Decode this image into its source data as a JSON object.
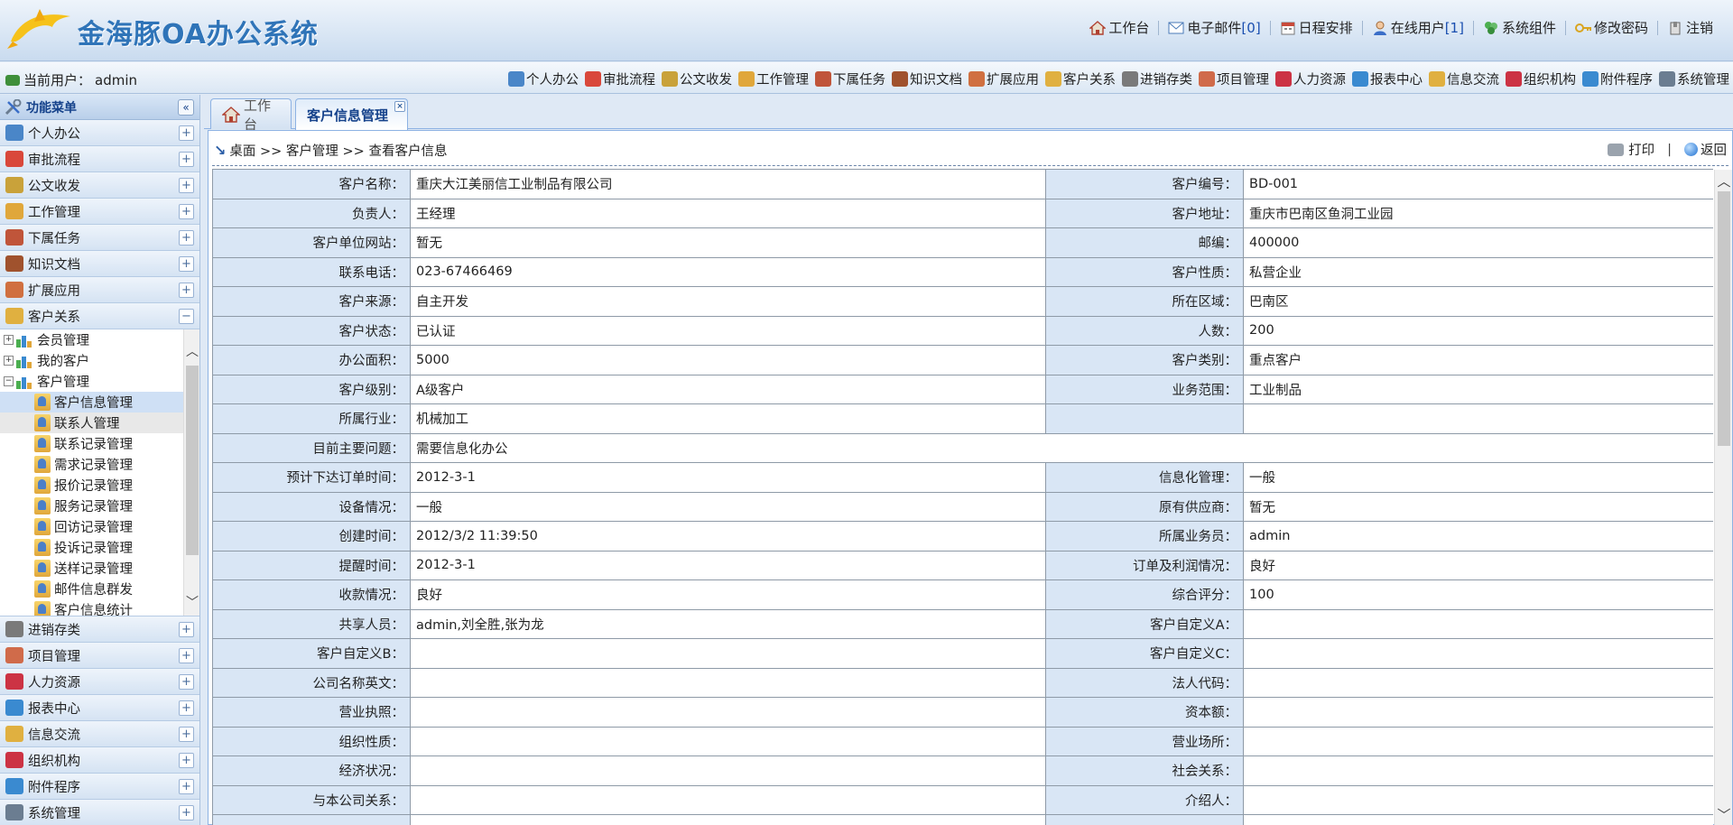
{
  "app": {
    "title": "金海豚OA办公系统"
  },
  "top_nav": [
    {
      "label": "工作台",
      "icon": "home-icon"
    },
    {
      "label": "电子邮件",
      "count": "[0]",
      "icon": "mail-icon"
    },
    {
      "label": "日程安排",
      "icon": "calendar-icon"
    },
    {
      "label": "在线用户",
      "count": "[1]",
      "icon": "user-icon"
    },
    {
      "label": "系统组件",
      "icon": "puzzle-icon"
    },
    {
      "label": "修改密码",
      "icon": "key-icon"
    },
    {
      "label": "注销",
      "icon": "logout-icon"
    }
  ],
  "current_user": {
    "label": "当前用户：",
    "name": "admin"
  },
  "module_nav": [
    {
      "label": "个人办公",
      "color": "#4a86c8"
    },
    {
      "label": "审批流程",
      "color": "#d9483b"
    },
    {
      "label": "公文收发",
      "color": "#c9a23a"
    },
    {
      "label": "工作管理",
      "color": "#e0a73b"
    },
    {
      "label": "下属任务",
      "color": "#c0553a"
    },
    {
      "label": "知识文档",
      "color": "#a0522d"
    },
    {
      "label": "扩展应用",
      "color": "#d07040"
    },
    {
      "label": "客户关系",
      "color": "#e0b040"
    },
    {
      "label": "进销存类",
      "color": "#7a7a7a"
    },
    {
      "label": "项目管理",
      "color": "#d06b4a"
    },
    {
      "label": "人力资源",
      "color": "#cc3344"
    },
    {
      "label": "报表中心",
      "color": "#3a8ad0"
    },
    {
      "label": "信息交流",
      "color": "#e0b040"
    },
    {
      "label": "组织机构",
      "color": "#cc3344"
    },
    {
      "label": "附件程序",
      "color": "#3a8ad0"
    },
    {
      "label": "系统管理",
      "color": "#6b7d91"
    }
  ],
  "sidebar": {
    "title": "功能菜单",
    "top_items": [
      {
        "label": "个人办公",
        "color": "#4a86c8"
      },
      {
        "label": "审批流程",
        "color": "#d9483b"
      },
      {
        "label": "公文收发",
        "color": "#c9a23a"
      },
      {
        "label": "工作管理",
        "color": "#e0a73b"
      },
      {
        "label": "下属任务",
        "color": "#c0553a"
      },
      {
        "label": "知识文档",
        "color": "#a0522d"
      },
      {
        "label": "扩展应用",
        "color": "#d07040"
      },
      {
        "label": "客户关系",
        "color": "#e0b040",
        "expanded": true
      }
    ],
    "tree": [
      {
        "label": "会员管理",
        "level": 0,
        "expand": "+"
      },
      {
        "label": "我的客户",
        "level": 0,
        "expand": "+"
      },
      {
        "label": "客户管理",
        "level": 0,
        "expand": "-"
      },
      {
        "label": "客户信息管理",
        "level": 1,
        "selected": true
      },
      {
        "label": "联系人管理",
        "level": 1,
        "hover": true
      },
      {
        "label": "联系记录管理",
        "level": 1
      },
      {
        "label": "需求记录管理",
        "level": 1
      },
      {
        "label": "报价记录管理",
        "level": 1
      },
      {
        "label": "服务记录管理",
        "level": 1
      },
      {
        "label": "回访记录管理",
        "level": 1
      },
      {
        "label": "投诉记录管理",
        "level": 1
      },
      {
        "label": "送样记录管理",
        "level": 1
      },
      {
        "label": "邮件信息群发",
        "level": 1
      },
      {
        "label": "客户信息统计",
        "level": 1
      }
    ],
    "bottom_items": [
      {
        "label": "进销存类",
        "color": "#7a7a7a"
      },
      {
        "label": "项目管理",
        "color": "#d06b4a"
      },
      {
        "label": "人力资源",
        "color": "#cc3344"
      },
      {
        "label": "报表中心",
        "color": "#3a8ad0"
      },
      {
        "label": "信息交流",
        "color": "#e0b040"
      },
      {
        "label": "组织机构",
        "color": "#cc3344"
      },
      {
        "label": "附件程序",
        "color": "#3a8ad0"
      },
      {
        "label": "系统管理",
        "color": "#6b7d91"
      }
    ]
  },
  "tabs": [
    {
      "label": "工作台"
    },
    {
      "label": "客户信息管理",
      "active": true
    }
  ],
  "breadcrumb": "桌面 >> 客户管理 >> 查看客户信息",
  "actions": {
    "print": "打印",
    "back": "返回"
  },
  "rows": [
    [
      [
        "客户名称：",
        "重庆大江美丽信工业制品有限公司"
      ],
      [
        "客户编号：",
        "BD-001"
      ]
    ],
    [
      [
        "负责人：",
        "王经理"
      ],
      [
        "客户地址：",
        "重庆市巴南区鱼洞工业园"
      ]
    ],
    [
      [
        "客户单位网站：",
        "暂无"
      ],
      [
        "邮编：",
        "400000"
      ]
    ],
    [
      [
        "联系电话：",
        "023-67466469"
      ],
      [
        "客户性质：",
        "私营企业"
      ]
    ],
    [
      [
        "客户来源：",
        "自主开发"
      ],
      [
        "所在区域：",
        "巴南区"
      ]
    ],
    [
      [
        "客户状态：",
        "已认证"
      ],
      [
        "人数：",
        "200"
      ]
    ],
    [
      [
        "办公面积：",
        "5000"
      ],
      [
        "客户类别：",
        "重点客户"
      ]
    ],
    [
      [
        "客户级别：",
        "A级客户"
      ],
      [
        "业务范围：",
        "工业制品"
      ]
    ],
    [
      [
        "所属行业：",
        "机械加工"
      ],
      [
        "",
        ""
      ]
    ],
    [
      [
        "目前主要问题：",
        "需要信息化办公"
      ]
    ],
    [
      [
        "预计下达订单时间：",
        "2012-3-1"
      ],
      [
        "信息化管理：",
        "一般"
      ]
    ],
    [
      [
        "设备情况：",
        "一般"
      ],
      [
        "原有供应商：",
        "暂无"
      ]
    ],
    [
      [
        "创建时间：",
        "2012/3/2 11:39:50"
      ],
      [
        "所属业务员：",
        "admin"
      ]
    ],
    [
      [
        "提醒时间：",
        "2012-3-1"
      ],
      [
        "订单及利润情况：",
        "良好"
      ]
    ],
    [
      [
        "收款情况：",
        "良好"
      ],
      [
        "综合评分：",
        "100"
      ]
    ],
    [
      [
        "共享人员：",
        "admin,刘全胜,张为龙"
      ],
      [
        "客户自定义A：",
        ""
      ]
    ],
    [
      [
        "客户自定义B：",
        ""
      ],
      [
        "客户自定义C：",
        ""
      ]
    ],
    [
      [
        "公司名称英文：",
        ""
      ],
      [
        "法人代码：",
        ""
      ]
    ],
    [
      [
        "营业执照：",
        ""
      ],
      [
        "资本额：",
        ""
      ]
    ],
    [
      [
        "组织性质：",
        ""
      ],
      [
        "营业场所：",
        ""
      ]
    ],
    [
      [
        "经济状况：",
        ""
      ],
      [
        "社会关系：",
        ""
      ]
    ],
    [
      [
        "与本公司关系：",
        ""
      ],
      [
        "介绍人：",
        ""
      ]
    ],
    [
      [
        "",
        ""
      ],
      [
        "",
        ""
      ]
    ]
  ]
}
